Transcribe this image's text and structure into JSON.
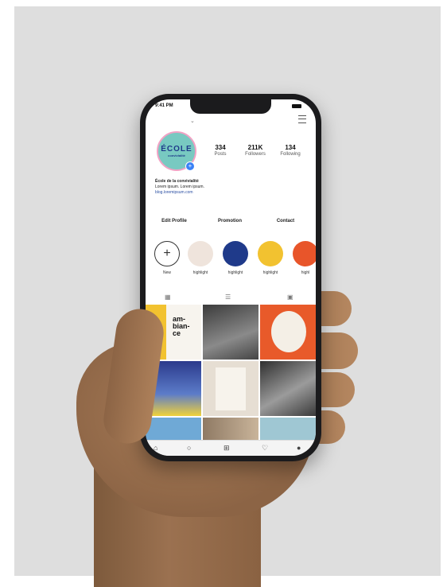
{
  "status_bar": {
    "time": "9:41 PM"
  },
  "profile": {
    "avatar_text": "ÉCOLE",
    "avatar_subtext": "convivialité",
    "stats": [
      {
        "value": "334",
        "label": "Posts"
      },
      {
        "value": "211K",
        "label": "Followers"
      },
      {
        "value": "134",
        "label": "Following"
      }
    ],
    "name": "École de la convivialité",
    "bio": "Lorem ipsum. Lorem ipsum.",
    "link": "blog.loremipsum.com"
  },
  "actions": {
    "edit_profile": "Edit Profile",
    "promotion": "Promotion",
    "contact": "Contact"
  },
  "highlights": [
    {
      "label": "New",
      "color": "#ffffff"
    },
    {
      "label": "highlight",
      "color": "#efe4dc"
    },
    {
      "label": "highlight",
      "color": "#1f3a8a"
    },
    {
      "label": "highlight",
      "color": "#f2c230"
    },
    {
      "label": "highl",
      "color": "#e8552a"
    }
  ],
  "grid_texts": {
    "post1": "am-\nbian-\nce"
  },
  "icons": [
    "chevron-down-icon",
    "menu-icon",
    "grid-icon",
    "list-icon",
    "tagged-icon",
    "home-icon",
    "search-icon",
    "add-icon",
    "heart-icon",
    "profile-icon"
  ]
}
